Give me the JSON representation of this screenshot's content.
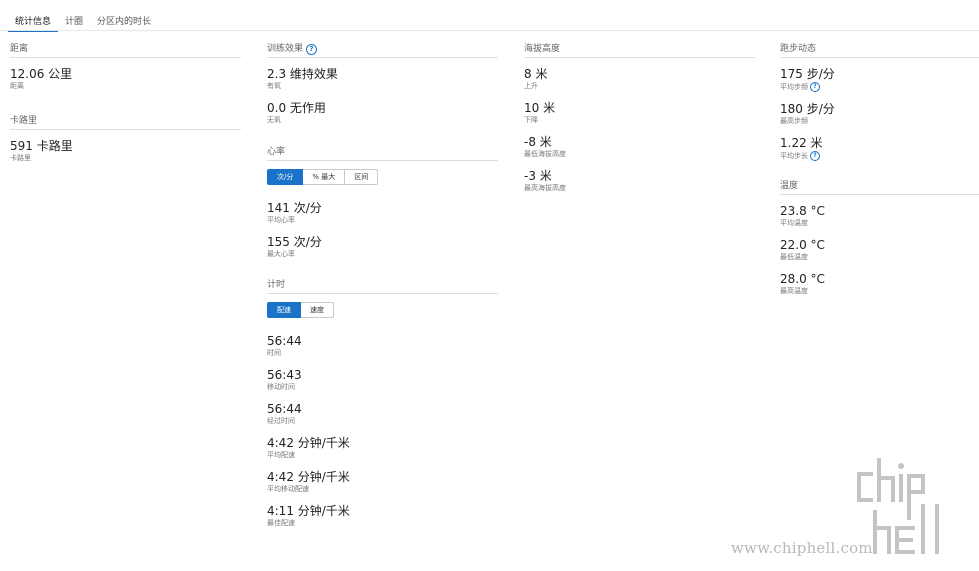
{
  "tabs": [
    "统计信息",
    "计圈",
    "分区内的时长"
  ],
  "colors": {
    "accent": "#1a73c8"
  },
  "distance": {
    "title": "距离",
    "value": "12.06 公里",
    "label": "距离"
  },
  "calories": {
    "title": "卡路里",
    "value": "591 卡路里",
    "label": "卡路里"
  },
  "training_effect": {
    "title": "训练效果",
    "aerobic_value": "2.3 维持效果",
    "aerobic_label": "有氧",
    "anaerobic_value": "0.0 无作用",
    "anaerobic_label": "无氧"
  },
  "heart_rate": {
    "title": "心率",
    "toggle": [
      "次/分",
      "% 最大",
      "区间"
    ],
    "avg_value": "141 次/分",
    "avg_label": "平均心率",
    "max_value": "155 次/分",
    "max_label": "最大心率"
  },
  "timing": {
    "title": "计时",
    "toggle": [
      "配速",
      "速度"
    ],
    "stats": [
      {
        "value": "56:44",
        "label": "时间"
      },
      {
        "value": "56:43",
        "label": "移动时间"
      },
      {
        "value": "56:44",
        "label": "经过时间"
      },
      {
        "value": "4:42 分钟/千米",
        "label": "平均配速"
      },
      {
        "value": "4:42 分钟/千米",
        "label": "平均移动配速"
      },
      {
        "value": "4:11 分钟/千米",
        "label": "最佳配速"
      }
    ]
  },
  "elevation": {
    "title": "海拔高度",
    "stats": [
      {
        "value": "8 米",
        "label": "上升"
      },
      {
        "value": "10 米",
        "label": "下降"
      },
      {
        "value": "-8 米",
        "label": "最低海拔高度"
      },
      {
        "value": "-3 米",
        "label": "最高海拔高度"
      }
    ]
  },
  "running_dynamics": {
    "title": "跑步动态",
    "stats": [
      {
        "value": "175 步/分",
        "label": "平均步频"
      },
      {
        "value": "180 步/分",
        "label": "最高步频"
      },
      {
        "value": "1.22 米",
        "label": "平均步长"
      }
    ]
  },
  "temperature": {
    "title": "温度",
    "stats": [
      {
        "value": "23.8 °C",
        "label": "平均温度"
      },
      {
        "value": "22.0 °C",
        "label": "最低温度"
      },
      {
        "value": "28.0 °C",
        "label": "最高温度"
      }
    ]
  },
  "watermark": {
    "url": "www.chiphell.com"
  }
}
